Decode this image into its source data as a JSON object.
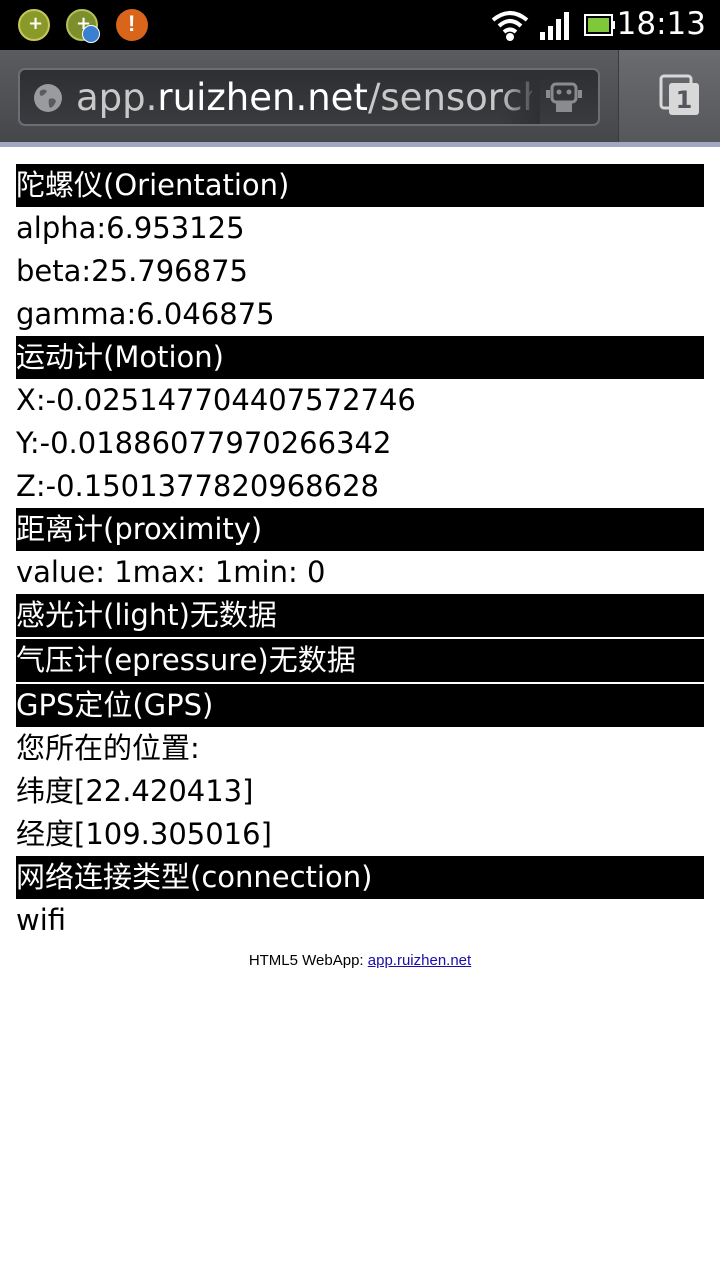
{
  "status_bar": {
    "time": "18:13",
    "alert_glyph": "!",
    "icons": [
      "game-icon",
      "game-update-icon",
      "alert-icon",
      "wifi-icon",
      "signal-icon",
      "battery-icon"
    ]
  },
  "browser": {
    "url_prefix": "app.",
    "url_host": "ruizhen.net",
    "url_path": "/sensorche",
    "tab_count": "1"
  },
  "sections": {
    "orientation": {
      "title": "陀螺仪(Orientation)",
      "alpha": "alpha:6.953125",
      "beta": "beta:25.796875",
      "gamma": "gamma:6.046875"
    },
    "motion": {
      "title": "运动计(Motion)",
      "x": "X:-0.025147704407572746",
      "y": "Y:-0.01886077970266342",
      "z": "Z:-0.1501377820968628"
    },
    "proximity": {
      "title": "距离计(proximity)",
      "value": "value: 1max: 1min: 0"
    },
    "light": {
      "title": "感光计(light)无数据"
    },
    "pressure": {
      "title": "气压计(epressure)无数据"
    },
    "gps": {
      "title": "GPS定位(GPS)",
      "label": "您所在的位置:",
      "lat": "纬度[22.420413]",
      "lng": "经度[109.305016]"
    },
    "connection": {
      "title": "网络连接类型(connection)",
      "value": "wifi"
    }
  },
  "footer": {
    "text": "HTML5 WebApp: ",
    "link": "app.ruizhen.net"
  }
}
